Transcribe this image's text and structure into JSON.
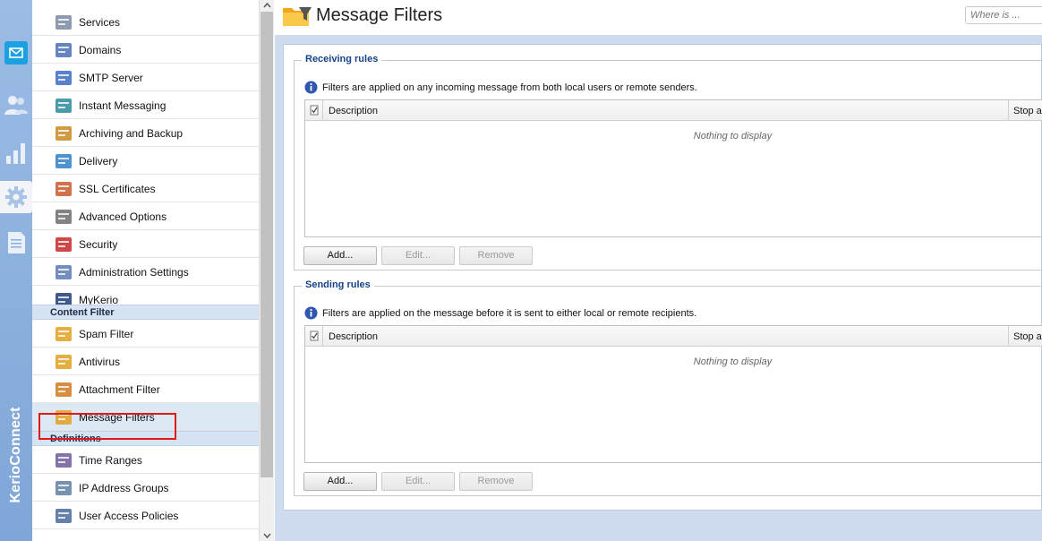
{
  "app": {
    "brand": "KerioConnect"
  },
  "nav": {
    "items_top": [
      {
        "label": "Services",
        "icon": "services-icon"
      },
      {
        "label": "Domains",
        "icon": "domains-icon"
      },
      {
        "label": "SMTP Server",
        "icon": "smtp-server-icon"
      },
      {
        "label": "Instant Messaging",
        "icon": "instant-messaging-icon"
      },
      {
        "label": "Archiving and Backup",
        "icon": "archiving-icon"
      },
      {
        "label": "Delivery",
        "icon": "delivery-icon"
      },
      {
        "label": "SSL Certificates",
        "icon": "certificate-icon"
      },
      {
        "label": "Advanced Options",
        "icon": "advanced-options-icon"
      },
      {
        "label": "Security",
        "icon": "security-icon"
      },
      {
        "label": "Administration Settings",
        "icon": "administration-icon"
      },
      {
        "label": "MyKerio",
        "icon": "mykerio-icon"
      }
    ],
    "section_content_filter": "Content Filter",
    "items_content_filter": [
      {
        "label": "Spam Filter",
        "icon": "spam-filter-icon"
      },
      {
        "label": "Antivirus",
        "icon": "antivirus-icon"
      },
      {
        "label": "Attachment Filter",
        "icon": "attachment-filter-icon"
      },
      {
        "label": "Message Filters",
        "icon": "message-filters-icon"
      }
    ],
    "section_definitions": "Definitions",
    "items_definitions": [
      {
        "label": "Time Ranges",
        "icon": "time-ranges-icon"
      },
      {
        "label": "IP Address Groups",
        "icon": "ip-groups-icon"
      },
      {
        "label": "User Access Policies",
        "icon": "user-policies-icon"
      }
    ],
    "selected": "Message Filters"
  },
  "header": {
    "title": "Message Filters",
    "search_placeholder": "Where is ..."
  },
  "receiving": {
    "legend": "Receiving rules",
    "info": "Filters are applied on any incoming message from both local users or remote senders.",
    "col_description": "Description",
    "col_stop": "Stop ar",
    "empty": "Nothing to display",
    "add": "Add...",
    "edit": "Edit...",
    "remove": "Remove"
  },
  "sending": {
    "legend": "Sending rules",
    "info": "Filters are applied on the message before it is sent to either local or remote recipients.",
    "col_description": "Description",
    "col_stop": "Stop ar",
    "empty": "Nothing to display",
    "add": "Add...",
    "edit": "Edit...",
    "remove": "Remove"
  },
  "colors": {
    "rail": "#8eb1de",
    "accent": "#15428b",
    "highlight": "#e01818",
    "content_bg": "#cfdcf0"
  }
}
